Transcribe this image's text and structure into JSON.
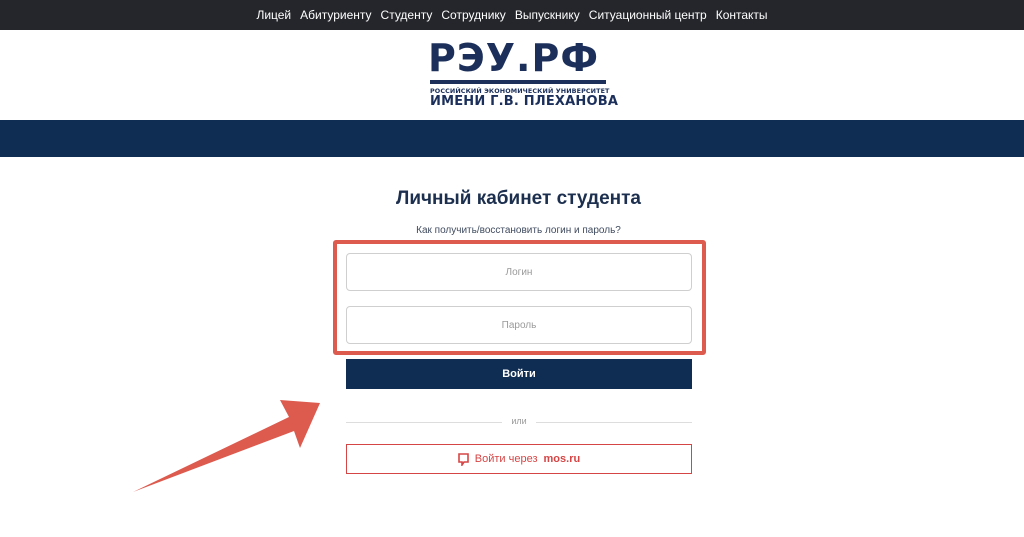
{
  "nav": {
    "items": [
      {
        "label": "Лицей"
      },
      {
        "label": "Абитуриенту"
      },
      {
        "label": "Студенту"
      },
      {
        "label": "Сотруднику"
      },
      {
        "label": "Выпускнику"
      },
      {
        "label": "Ситуационный центр"
      },
      {
        "label": "Контакты"
      }
    ]
  },
  "logo": {
    "main": "РЭУ.РФ",
    "line1": "РОССИЙСКИЙ ЭКОНОМИЧЕСКИЙ УНИВЕРСИТЕТ",
    "line2": "ИМЕНИ Г.В. ПЛЕХАНОВА"
  },
  "page": {
    "title": "Личный кабинет студента",
    "help_link": "Как получить/восстановить логин и пароль?"
  },
  "form": {
    "login_placeholder": "Логин",
    "password_placeholder": "Пароль",
    "submit_label": "Войти",
    "divider": "или",
    "mos_prefix": "Войти через",
    "mos_brand": "mos.ru"
  },
  "colors": {
    "nav_bg": "#24262b",
    "brand_navy": "#0f2c52",
    "highlight": "#dc5a4e",
    "mos_red": "#d64545"
  },
  "icons": {
    "mos": "mos-ru-icon",
    "annotation": "arrow-annotation"
  }
}
